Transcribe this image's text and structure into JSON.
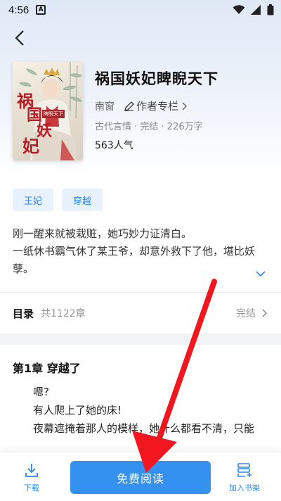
{
  "status": {
    "time": "4:56",
    "notif_letter": "A"
  },
  "book": {
    "title": "祸国妖妃睥睨天下",
    "author": "南窗",
    "author_link": "作者专栏",
    "meta": "古代言情 · 完结 · 226万字",
    "popularity": "563人气",
    "cover": {
      "big_chars": [
        "祸",
        "国",
        "妖",
        "妃"
      ],
      "small_title": "睥睨天下"
    }
  },
  "tags": [
    "王妃",
    "穿越"
  ],
  "description": {
    "line1": "刚一醒来就被栽赃，她巧妙力证清白。",
    "line2": "一纸休书霸气休了某王爷，却意外救下了他，堪比妖孽。"
  },
  "toc": {
    "label": "目录",
    "count": "共1122章",
    "status": "完结"
  },
  "chapter": {
    "title": "第1章  穿越了",
    "lines": [
      "嗯?",
      "有人爬上了她的床!",
      "夜幕遮掩着那人的模样，她什么都看不清，只能"
    ]
  },
  "bottom": {
    "download": "下载",
    "read": "免费阅读",
    "shelf": "加入书架"
  },
  "colors": {
    "accent": "#3591f0",
    "tag_bg": "#e8f2fd",
    "annotation_arrow": "#f2171f"
  }
}
